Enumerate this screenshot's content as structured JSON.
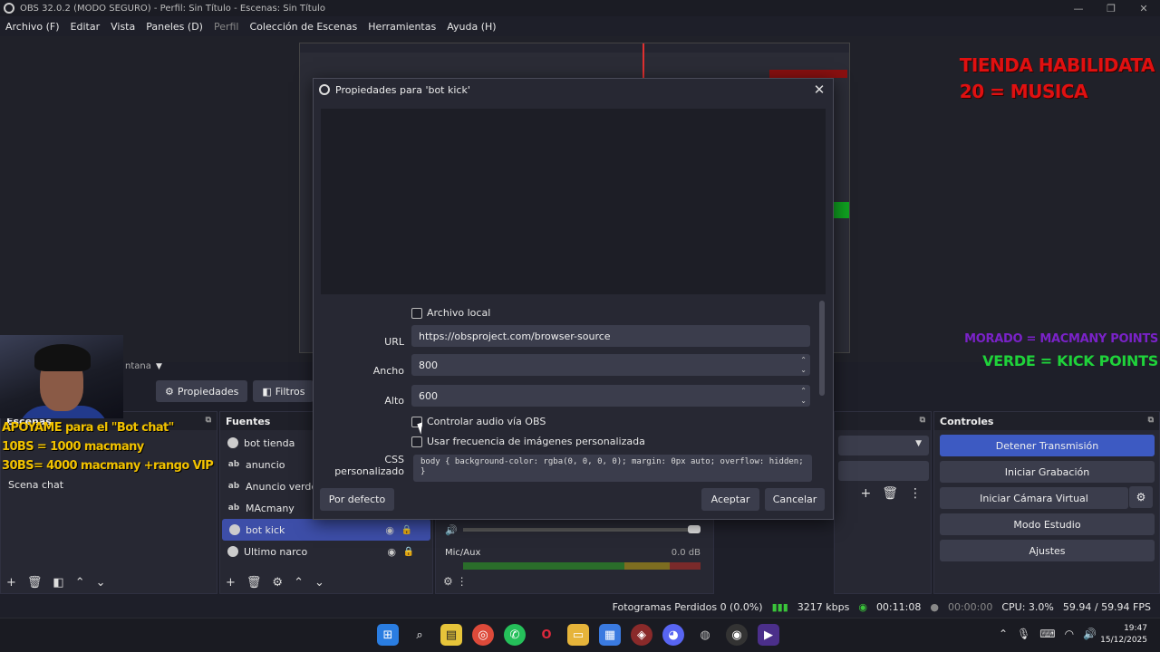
{
  "window": {
    "title": "OBS 32.0.2 (MODO SEGURO) - Perfil: Sin Título - Escenas: Sin Título",
    "controls": [
      "—",
      "❐",
      "✕"
    ]
  },
  "menu": [
    "Archivo (F)",
    "Editar",
    "Vista",
    "Paneles (D)",
    "Perfil",
    "Colección de Escenas",
    "Herramientas",
    "Ayuda (H)"
  ],
  "preview_overlays": {
    "tienda_line1": "TIENDA HABILIDATA",
    "tienda_line2": "20 = MUSICA",
    "morado": "MORADO = MACMANY POINTS",
    "verde": "VERDE = KICK POINTS",
    "apoyame": [
      "APOYAME para el \"Bot chat\"",
      "10BS = 1000 macmany",
      "30BS= 4000 macmany +rango VIP"
    ]
  },
  "source_toolbar": {
    "window_label": "ntana",
    "properties": "Propiedades",
    "filters": "Filtros"
  },
  "scenes": {
    "header": "Escenas",
    "items": [
      "Scena chat"
    ]
  },
  "sources": {
    "header": "Fuentes",
    "items": [
      {
        "name": "bot tienda",
        "icon": "browser-icon"
      },
      {
        "name": "anuncio",
        "icon": "text-icon"
      },
      {
        "name": "Anuncio verde",
        "icon": "text-icon"
      },
      {
        "name": "MAcmany",
        "icon": "text-icon"
      },
      {
        "name": "bot kick",
        "icon": "browser-icon",
        "selected": true
      },
      {
        "name": "Ultimo narco",
        "icon": "browser-icon"
      }
    ]
  },
  "mixer": {
    "channel": "Mic/Aux",
    "db": "0.0 dB"
  },
  "controls": {
    "header": "Controles",
    "buttons": [
      "Detener Transmisión",
      "Iniciar Grabación",
      "Iniciar Cámara Virtual",
      "Modo Estudio",
      "Ajustes"
    ]
  },
  "statusbar": {
    "dropped": "Fotogramas Perdidos 0 (0.0%)",
    "kbps": "3217 kbps",
    "stream_time": "00:11:08",
    "rec_time": "00:00:00",
    "cpu": "CPU: 3.0%",
    "fps": "59.94 / 59.94 FPS"
  },
  "dialog": {
    "title": "Propiedades para 'bot kick'",
    "local_file": "Archivo local",
    "url_label": "URL",
    "url_value": "https://obsproject.com/browser-source",
    "width_label": "Ancho",
    "width_value": "800",
    "height_label": "Alto",
    "height_value": "600",
    "control_audio": "Controlar audio vía OBS",
    "custom_fps": "Usar frecuencia de imágenes personalizada",
    "css_label": "CSS personalizado",
    "css_value": "body { background-color: rgba(0, 0, 0, 0); margin: 0px auto; overflow: hidden; }",
    "defaults": "Por defecto",
    "accept": "Aceptar",
    "cancel": "Cancelar"
  },
  "clock": {
    "time": "19:47",
    "date": "15/12/2025"
  },
  "colors": {
    "accent": "#3d5ac2",
    "overlay_red": "#e01010",
    "overlay_purple": "#7a22c8",
    "overlay_green": "#1fd23a",
    "overlay_yellow": "#f2c200"
  }
}
